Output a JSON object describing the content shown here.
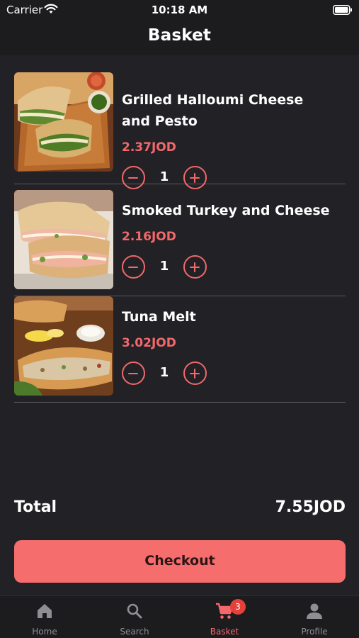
{
  "status_bar": {
    "carrier": "Carrier",
    "time": "10:18 AM"
  },
  "header": {
    "title": "Basket"
  },
  "items": [
    {
      "name": "Grilled Halloumi Cheese and Pesto",
      "price": "2.37JOD",
      "quantity": "1",
      "image": "halloumi-sandwich-photo"
    },
    {
      "name": "Smoked Turkey and Cheese",
      "price": "2.16JOD",
      "quantity": "1",
      "image": "turkey-sandwich-photo"
    },
    {
      "name": "Tuna Melt",
      "price": "3.02JOD",
      "quantity": "1",
      "image": "tuna-melt-photo"
    }
  ],
  "summary": {
    "total_label": "Total",
    "total_value": "7.55JOD"
  },
  "checkout": {
    "label": "Checkout"
  },
  "tab_bar": {
    "tabs": [
      {
        "label": "Home",
        "icon": "home-icon"
      },
      {
        "label": "Search",
        "icon": "search-icon"
      },
      {
        "label": "Basket",
        "icon": "cart-icon",
        "badge": "3",
        "active": true
      },
      {
        "label": "Profile",
        "icon": "person-icon"
      }
    ]
  },
  "colors": {
    "accent": "#f2686b",
    "background": "#222226",
    "bar": "#1c1c1f",
    "button": "#f56d6d",
    "badge": "#e5413b"
  }
}
